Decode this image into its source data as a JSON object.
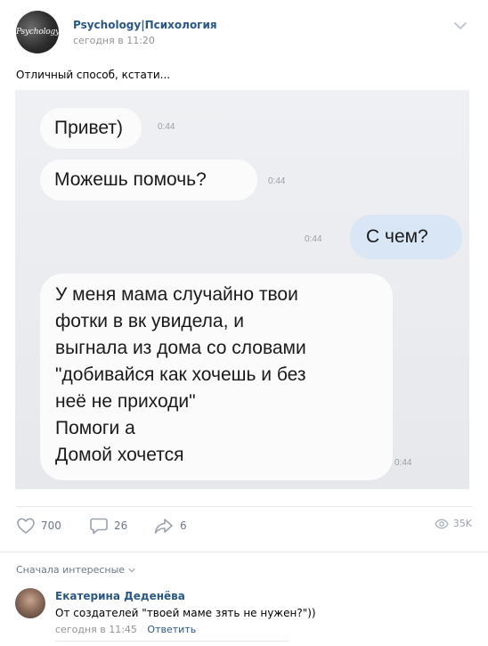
{
  "post": {
    "group_name": "Psychology|Психология",
    "avatar_text": "Psychology",
    "time": "сегодня в 11:20",
    "text": "Отличный способ, кстати..."
  },
  "photo": {
    "messages": [
      {
        "direction": "in",
        "text": "Привет)",
        "time": "0:44"
      },
      {
        "direction": "in",
        "text": "Можешь помочь?",
        "time": "0:44"
      },
      {
        "direction": "out",
        "text": "С чем?",
        "time": "0:44"
      },
      {
        "direction": "in",
        "lines": [
          "У меня мама случайно твои",
          "фотки в вк увидела, и",
          "выгнала из дома со словами",
          "\"добивайся как хочешь и без",
          "неё не приходи\"",
          "Помоги а",
          "Домой хочется"
        ],
        "time": "0:44"
      }
    ]
  },
  "actions": {
    "likes": "700",
    "comments": "26",
    "shares": "6",
    "views": "35K"
  },
  "comments_section": {
    "sort_label": "Сначала интересные",
    "comment": {
      "author": "Екатерина Деденёва",
      "text": "От создателей \"твоей маме зять не нужен?\"))",
      "time": "сегодня в 11:45",
      "reply_label": "Ответить"
    }
  },
  "colors": {
    "link": "#2a5885",
    "meta": "#939393",
    "icon": "#99a2ad",
    "outgoing_bubble": "#d9e6f5"
  },
  "icons": [
    "chevron-down-icon",
    "heart-icon",
    "comment-icon",
    "share-icon",
    "eye-icon"
  ]
}
